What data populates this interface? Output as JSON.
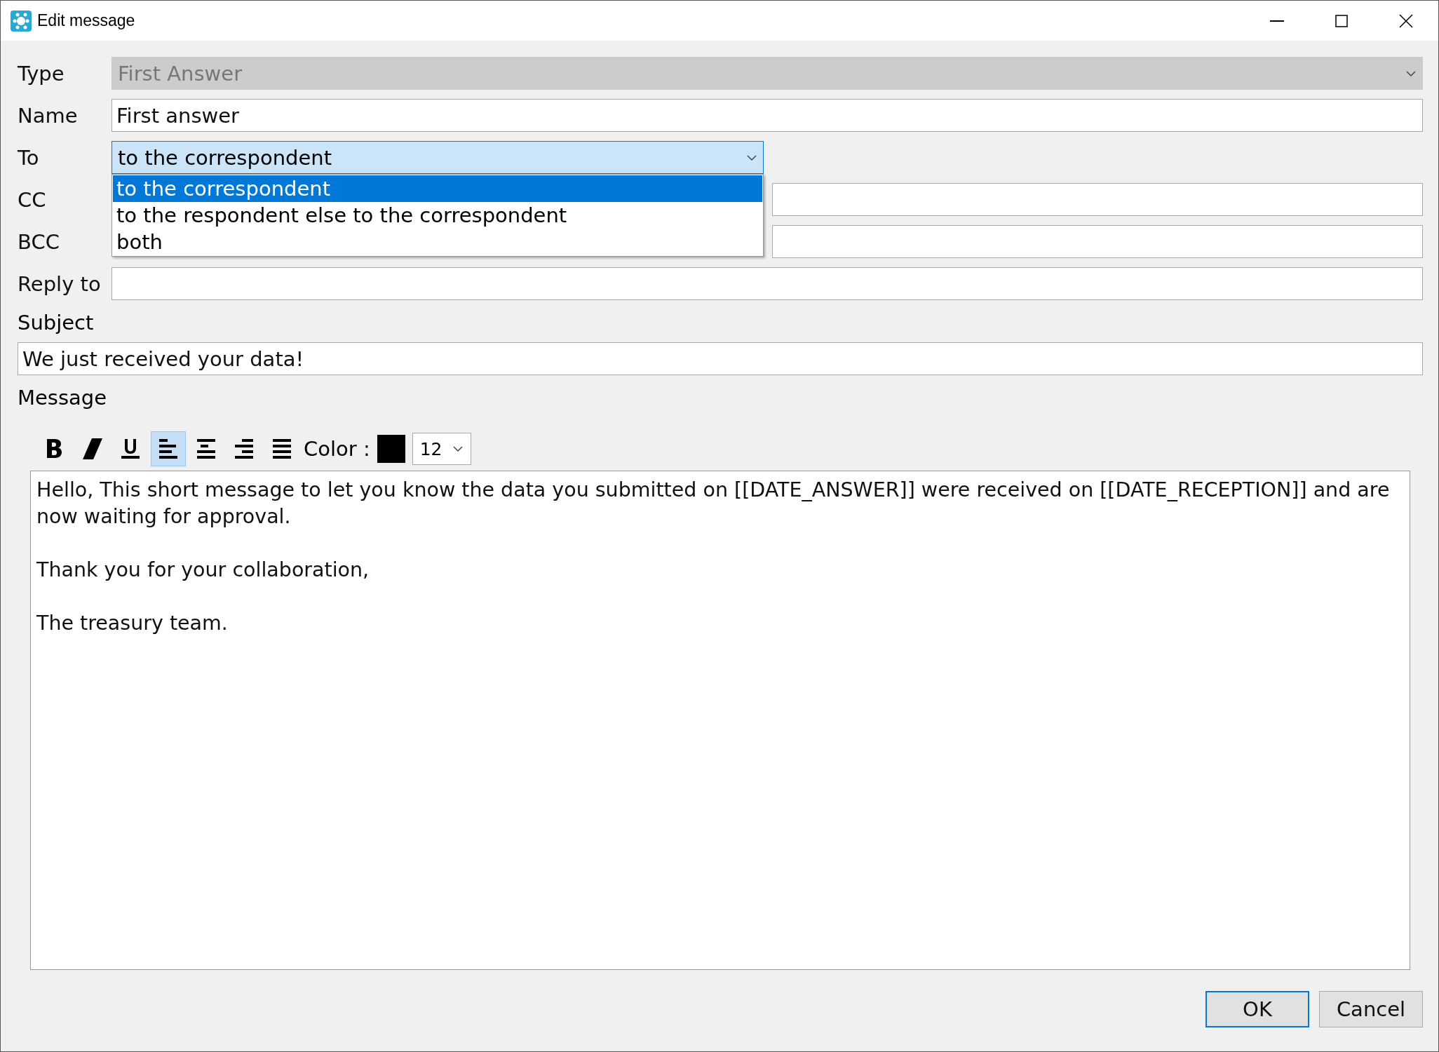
{
  "window": {
    "title": "Edit message"
  },
  "fields": [
    {
      "label": "Type",
      "kind": "select",
      "value": "First Answer",
      "disabled": true
    },
    {
      "label": "Name",
      "kind": "text",
      "value": "First answer"
    },
    {
      "label": "To",
      "kind": "dropdown",
      "value": "to the correspondent",
      "expanded": true,
      "options": [
        {
          "label": "to the correspondent",
          "selected": true
        },
        {
          "label": "to the respondent else to the correspondent",
          "selected": false
        },
        {
          "label": "both",
          "selected": false
        }
      ]
    },
    {
      "label": "CC",
      "kind": "side"
    },
    {
      "label": "BCC",
      "kind": "side"
    },
    {
      "label": "Reply to",
      "kind": "text"
    }
  ],
  "subject": {
    "label": "Subject",
    "value": "We just received your data!"
  },
  "message": {
    "label": "Message",
    "toolbar": [
      {
        "kind": "bold",
        "selected": false
      },
      {
        "kind": "italic",
        "selected": false
      },
      {
        "kind": "underline",
        "selected": false
      },
      {
        "kind": "align-left",
        "selected": true
      },
      {
        "kind": "align-center",
        "selected": false
      },
      {
        "kind": "align-right",
        "selected": false
      },
      {
        "kind": "justify",
        "selected": false
      }
    ],
    "color_label": "Color :",
    "color": "#000000",
    "font_size": "12",
    "paragraphs": [
      "Hello, This short message to let you know the data you submitted on [[DATE_ANSWER]] were received on [[DATE_RECEPTION]] and are now waiting for approval.",
      "Thank you for your collaboration,",
      "The treasury team."
    ]
  },
  "buttons": [
    {
      "label": "OK",
      "default": true
    },
    {
      "label": "Cancel",
      "default": false
    }
  ]
}
